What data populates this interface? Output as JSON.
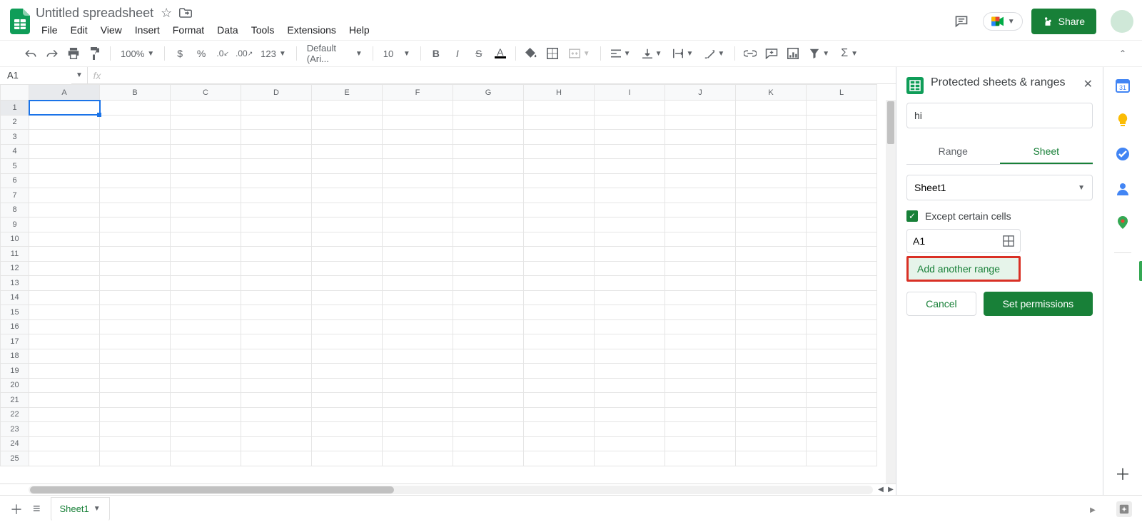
{
  "header": {
    "doc_title": "Untitled spreadsheet",
    "menus": [
      "File",
      "Edit",
      "View",
      "Insert",
      "Format",
      "Data",
      "Tools",
      "Extensions",
      "Help"
    ],
    "share_label": "Share"
  },
  "toolbar": {
    "zoom": "100%",
    "currency": "$",
    "percent": "%",
    "dec_dec": ".0",
    "inc_dec": ".00",
    "more_fmt": "123",
    "font": "Default (Ari...",
    "font_size": "10"
  },
  "formula_bar": {
    "namebox": "A1",
    "fx": "fx"
  },
  "grid": {
    "cols": [
      "A",
      "B",
      "C",
      "D",
      "E",
      "F",
      "G",
      "H",
      "I",
      "J",
      "K",
      "L"
    ],
    "rows": 25,
    "selected": "A1"
  },
  "side_panel": {
    "title": "Protected sheets & ranges",
    "desc_value": "hi",
    "tabs": {
      "range": "Range",
      "sheet": "Sheet",
      "active": "sheet"
    },
    "sheet_select": "Sheet1",
    "except_label": "Except certain cells",
    "except_checked": true,
    "except_range": "A1",
    "add_range": "Add another range",
    "cancel": "Cancel",
    "set_perm": "Set permissions"
  },
  "tabs_bar": {
    "sheet": "Sheet1"
  }
}
